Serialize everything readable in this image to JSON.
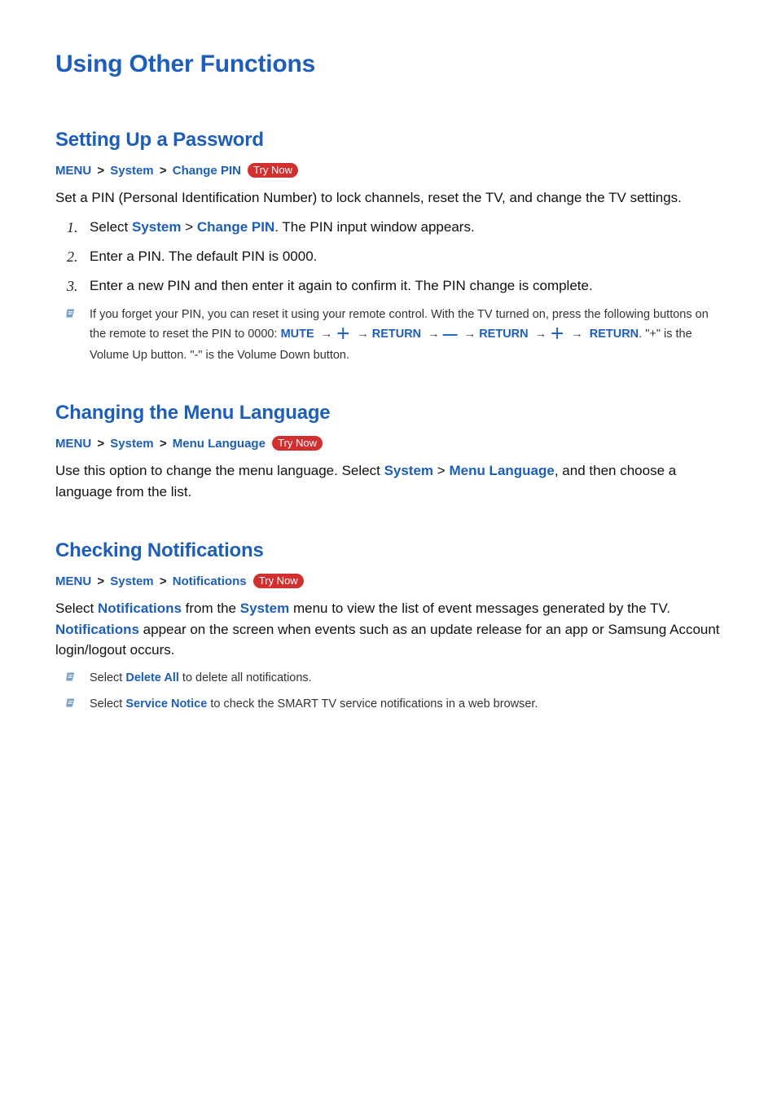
{
  "title": "Using Other Functions",
  "sec1": {
    "heading": "Setting Up a Password",
    "path": {
      "menu": "MENU",
      "system": "System",
      "item": "Change PIN",
      "trynow": "Try Now"
    },
    "intro": "Set a PIN (Personal Identification Number) to lock channels, reset the TV, and change the TV settings.",
    "steps": {
      "s1a": "Select ",
      "s1b": "System",
      "s1c": "Change PIN",
      "s1d": ". The PIN input window appears.",
      "s2": "Enter a PIN. The default PIN is 0000.",
      "s3": "Enter a new PIN and then enter it again to confirm it. The PIN change is complete."
    },
    "note": {
      "pre": "If you forget your PIN, you can reset it using your remote control. With the TV turned on, press the following buttons on the remote to reset the PIN to 0000: ",
      "mute": "MUTE",
      "return": "RETURN",
      "post": ". \"+\" is the Volume Up button. \"-\" is the Volume Down button."
    }
  },
  "sec2": {
    "heading": "Changing the Menu Language",
    "path": {
      "menu": "MENU",
      "system": "System",
      "item": "Menu Language",
      "trynow": "Try Now"
    },
    "body": {
      "a": "Use this option to change the menu language. Select ",
      "b": "System",
      "c": "Menu Language",
      "d": ", and then choose a language from the list."
    }
  },
  "sec3": {
    "heading": "Checking Notifications",
    "path": {
      "menu": "MENU",
      "system": "System",
      "item": "Notifications",
      "trynow": "Try Now"
    },
    "body": {
      "a": "Select ",
      "b": "Notifications",
      "c": " from the ",
      "d": "System",
      "e": " menu to view the list of event messages generated by the TV. ",
      "f": "Notifications",
      "g": " appear on the screen when events such as an update release for an app or Samsung Account login/logout occurs."
    },
    "note1": {
      "a": "Select ",
      "b": "Delete All",
      "c": " to delete all notifications."
    },
    "note2": {
      "a": "Select ",
      "b": "Service Notice",
      "c": " to check the SMART TV service notifications in a web browser."
    }
  },
  "glyphs": {
    "caret": ">",
    "arrow": "→",
    "plus": "＋",
    "minus": "—"
  }
}
